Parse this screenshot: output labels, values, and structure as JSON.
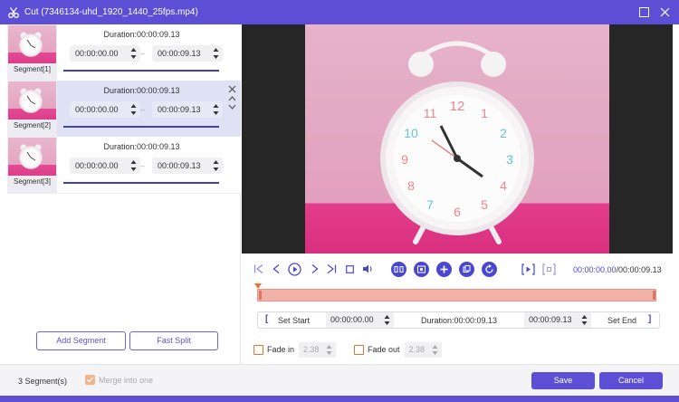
{
  "window": {
    "title": "Cut (7346134-uhd_1920_1440_25fps.mp4)"
  },
  "segments": [
    {
      "label": "Segment[1]",
      "duration": "Duration:00:00:09.13",
      "start": "00:00:00.00",
      "end": "00:00:09.13",
      "selected": false
    },
    {
      "label": "Segment[2]",
      "duration": "Duration:00:00:09.13",
      "start": "00:00:00.00",
      "end": "00:00:09.13",
      "selected": true
    },
    {
      "label": "Segment[3]",
      "duration": "Duration:00:00:09.13",
      "start": "00:00:00.00",
      "end": "00:00:09.13",
      "selected": false
    }
  ],
  "segment_separator": "–",
  "left_buttons": {
    "add_segment": "Add Segment",
    "fast_split": "Fast Split"
  },
  "player": {
    "current_time": "00:00:00.00",
    "total_time": "/00:00:09.13"
  },
  "set_row": {
    "bracket_open": "[",
    "set_start": "Set Start",
    "start_time": "00:00:00.00",
    "duration": "Duration:00:00:09.13",
    "end_time": "00:00:09.13",
    "set_end": "Set End",
    "bracket_close": "]"
  },
  "fade": {
    "fade_in_label": "Fade in",
    "fade_in_value": "2.38",
    "fade_out_label": "Fade out",
    "fade_out_value": "2.38"
  },
  "footer": {
    "segment_count": "3 Segment(s)",
    "merge_label": "Merge into one",
    "save": "Save",
    "cancel": "Cancel"
  },
  "colors": {
    "accent": "#5c4fd6",
    "segment_bar": "#3e3fc9",
    "timeline_fill": "#f3b2a8",
    "timeline_marker": "#e8732a",
    "checkbox_border": "#e8732a"
  }
}
